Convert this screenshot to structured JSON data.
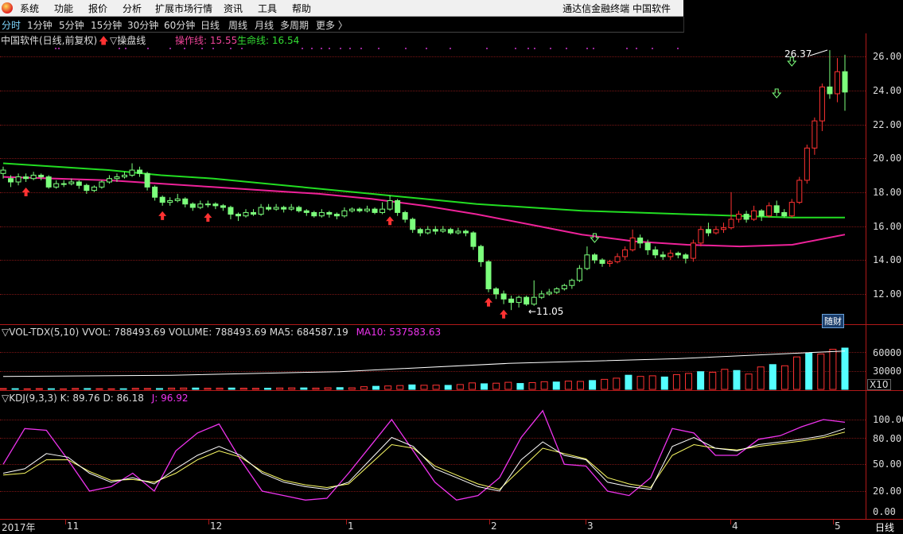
{
  "menu": {
    "items": [
      "系统",
      "功能",
      "报价",
      "分析",
      "扩展市场行情",
      "资讯",
      "工具",
      "帮助"
    ],
    "right_text": "通达信金融终端  中国软件"
  },
  "periods": {
    "items": [
      "分时",
      "1分钟",
      "5分钟",
      "15分钟",
      "30分钟",
      "60分钟",
      "日线",
      "周线",
      "月线",
      "多周期",
      "更多 〉"
    ]
  },
  "info": {
    "stock": "中国软件(日线,前复权)",
    "indicator": "▽操盘线",
    "op_line": "操作线: 15.55",
    "life_line": "生命线: 16.54"
  },
  "colors": {
    "up": "#ff3232",
    "down": "#54ffff",
    "green_candle": "#7cff7c",
    "ma_green": "#22dd22",
    "ma_pink": "#ee2299",
    "kdj_k": "#ffffff",
    "kdj_d": "#ffff66",
    "kdj_j": "#ee33ee"
  },
  "price_axis": {
    "labels": [
      "26.00",
      "24.00",
      "22.00",
      "20.00",
      "18.00",
      "16.00",
      "14.00",
      "12.00"
    ]
  },
  "annotations": {
    "high": "26.37",
    "low": "←11.05"
  },
  "badge": "随财",
  "volume": {
    "title": "▽VOL-TDX(5,10)  VVOL: 788493.69  VOLUME: 788493.69  MA5: 684587.19",
    "ma10": "MA10: 537583.63",
    "axis": [
      "60000",
      "30000"
    ],
    "unit": "X10"
  },
  "kdj": {
    "title": "▽KDJ(9,3,3)  K: 89.76  D: 86.18",
    "j": "J: 96.92",
    "axis": [
      "100.00",
      "80.00",
      "50.00",
      "20.00",
      "0.00"
    ]
  },
  "dates": {
    "labels": [
      "2017年",
      "11",
      "12",
      "1",
      "2",
      "3",
      "4",
      "5"
    ],
    "right": "日线"
  },
  "chart_data": {
    "type": "candlestick",
    "ylim": [
      11,
      26.6
    ],
    "candles": [
      [
        19.1,
        19.3,
        19.5,
        18.8
      ],
      [
        18.8,
        18.6,
        19.0,
        18.3
      ],
      [
        18.6,
        18.9,
        19.1,
        18.4
      ],
      [
        18.9,
        18.8,
        19.1,
        18.6
      ],
      [
        18.8,
        19.0,
        19.2,
        18.7
      ],
      [
        19.0,
        18.9,
        19.1,
        18.7
      ],
      [
        18.9,
        18.3,
        19.0,
        18.2
      ],
      [
        18.3,
        18.5,
        18.7,
        18.2
      ],
      [
        18.5,
        18.5,
        18.7,
        18.3
      ],
      [
        18.5,
        18.6,
        18.8,
        18.4
      ],
      [
        18.6,
        18.4,
        18.7,
        18.2
      ],
      [
        18.4,
        18.1,
        18.5,
        17.9
      ],
      [
        18.1,
        18.3,
        18.4,
        18.0
      ],
      [
        18.3,
        18.6,
        18.7,
        18.2
      ],
      [
        18.6,
        18.8,
        19.0,
        18.5
      ],
      [
        18.8,
        18.9,
        19.1,
        18.6
      ],
      [
        18.9,
        19.0,
        19.2,
        18.8
      ],
      [
        19.0,
        19.3,
        19.7,
        18.9
      ],
      [
        19.3,
        19.1,
        19.5,
        18.9
      ],
      [
        19.1,
        18.3,
        19.2,
        18.1
      ],
      [
        18.3,
        17.7,
        18.4,
        17.5
      ],
      [
        17.7,
        17.4,
        17.8,
        17.2
      ],
      [
        17.4,
        17.5,
        17.7,
        17.2
      ],
      [
        17.5,
        17.6,
        17.9,
        17.4
      ],
      [
        17.6,
        17.3,
        17.7,
        17.1
      ],
      [
        17.3,
        17.1,
        17.4,
        16.9
      ],
      [
        17.1,
        17.3,
        17.5,
        17.0
      ],
      [
        17.3,
        17.3,
        17.5,
        17.1
      ],
      [
        17.3,
        17.2,
        17.4,
        17.0
      ],
      [
        17.2,
        17.1,
        17.3,
        16.9
      ],
      [
        17.1,
        16.7,
        17.2,
        16.4
      ],
      [
        16.7,
        16.6,
        16.8,
        16.3
      ],
      [
        16.6,
        16.8,
        17.0,
        16.5
      ],
      [
        16.8,
        16.7,
        17.0,
        16.6
      ],
      [
        16.7,
        17.1,
        17.3,
        16.6
      ],
      [
        17.1,
        17.0,
        17.3,
        16.9
      ],
      [
        17.0,
        17.1,
        17.3,
        16.9
      ],
      [
        17.1,
        17.0,
        17.2,
        16.8
      ],
      [
        17.0,
        17.1,
        17.3,
        16.9
      ],
      [
        17.1,
        16.9,
        17.2,
        16.8
      ],
      [
        16.9,
        16.8,
        17.0,
        16.6
      ],
      [
        16.8,
        16.6,
        16.9,
        16.5
      ],
      [
        16.6,
        16.8,
        17.0,
        16.5
      ],
      [
        16.8,
        16.7,
        16.9,
        16.5
      ],
      [
        16.7,
        16.6,
        16.8,
        16.4
      ],
      [
        16.6,
        16.9,
        17.1,
        16.5
      ],
      [
        16.9,
        17.0,
        17.1,
        16.8
      ],
      [
        17.0,
        16.9,
        17.1,
        16.8
      ],
      [
        16.9,
        17.0,
        17.2,
        16.8
      ],
      [
        17.0,
        16.8,
        17.1,
        16.7
      ],
      [
        16.8,
        17.0,
        17.4,
        16.7
      ],
      [
        17.0,
        17.5,
        17.8,
        16.9
      ],
      [
        17.5,
        16.8,
        17.6,
        16.6
      ],
      [
        16.8,
        16.4,
        16.9,
        16.2
      ],
      [
        16.4,
        15.8,
        16.5,
        15.6
      ],
      [
        15.8,
        15.6,
        15.9,
        15.4
      ],
      [
        15.6,
        15.8,
        16.0,
        15.5
      ],
      [
        15.8,
        15.7,
        16.0,
        15.5
      ],
      [
        15.7,
        15.8,
        16.0,
        15.6
      ],
      [
        15.8,
        15.6,
        15.9,
        15.5
      ],
      [
        15.6,
        15.7,
        15.9,
        15.5
      ],
      [
        15.7,
        15.6,
        15.8,
        15.4
      ],
      [
        15.6,
        14.8,
        15.7,
        14.6
      ],
      [
        14.8,
        13.9,
        14.9,
        13.6
      ],
      [
        13.9,
        12.3,
        14.0,
        12.1
      ],
      [
        12.3,
        12.0,
        12.4,
        11.7
      ],
      [
        12.0,
        11.7,
        12.2,
        11.4
      ],
      [
        11.7,
        11.5,
        11.9,
        11.05
      ],
      [
        11.5,
        11.8,
        11.9,
        11.2
      ],
      [
        11.8,
        11.4,
        11.9,
        11.3
      ],
      [
        11.4,
        11.8,
        12.8,
        11.3
      ],
      [
        11.8,
        12.0,
        12.2,
        11.7
      ],
      [
        12.0,
        12.1,
        12.3,
        11.9
      ],
      [
        12.1,
        12.3,
        12.4,
        12.0
      ],
      [
        12.3,
        12.5,
        12.6,
        12.2
      ],
      [
        12.5,
        12.8,
        12.9,
        12.3
      ],
      [
        12.8,
        13.5,
        13.7,
        12.7
      ],
      [
        13.5,
        14.3,
        14.8,
        13.4
      ],
      [
        14.3,
        14.0,
        14.4,
        13.8
      ],
      [
        14.0,
        13.8,
        14.1,
        13.6
      ],
      [
        13.8,
        13.9,
        14.0,
        13.6
      ],
      [
        13.9,
        14.2,
        14.4,
        13.8
      ],
      [
        14.2,
        14.6,
        14.8,
        14.0
      ],
      [
        14.6,
        15.3,
        15.8,
        14.5
      ],
      [
        15.3,
        15.0,
        15.5,
        14.7
      ],
      [
        15.0,
        14.6,
        15.2,
        14.3
      ],
      [
        14.6,
        14.3,
        14.8,
        14.1
      ],
      [
        14.3,
        14.2,
        14.5,
        14.0
      ],
      [
        14.2,
        14.4,
        14.6,
        14.0
      ],
      [
        14.4,
        14.3,
        14.5,
        14.1
      ],
      [
        14.3,
        14.1,
        14.4,
        13.8
      ],
      [
        14.1,
        15.0,
        15.2,
        13.9
      ],
      [
        15.0,
        15.8,
        16.0,
        14.8
      ],
      [
        15.8,
        15.6,
        16.2,
        15.4
      ],
      [
        15.6,
        15.8,
        16.0,
        15.5
      ],
      [
        15.8,
        15.9,
        16.2,
        15.6
      ],
      [
        15.9,
        16.4,
        18.0,
        15.8
      ],
      [
        16.4,
        16.7,
        16.9,
        16.2
      ],
      [
        16.7,
        16.4,
        16.9,
        16.2
      ],
      [
        16.4,
        16.9,
        17.2,
        16.3
      ],
      [
        16.9,
        16.6,
        17.0,
        16.3
      ],
      [
        16.6,
        17.2,
        17.4,
        16.5
      ],
      [
        17.2,
        16.8,
        17.5,
        16.6
      ],
      [
        16.8,
        16.6,
        17.0,
        16.5
      ],
      [
        16.6,
        17.4,
        17.6,
        16.5
      ],
      [
        17.4,
        18.7,
        18.9,
        17.3
      ],
      [
        18.7,
        20.6,
        20.8,
        18.5
      ],
      [
        20.6,
        22.2,
        22.4,
        20.2
      ],
      [
        22.2,
        24.2,
        24.4,
        21.6
      ],
      [
        24.2,
        23.8,
        26.37,
        23.5
      ],
      [
        23.8,
        25.1,
        25.9,
        23.3
      ],
      [
        25.1,
        23.9,
        26.1,
        22.8
      ]
    ],
    "ma_green": [
      19.7,
      19.5,
      19.3,
      19.0,
      18.8,
      18.5,
      18.2,
      17.9,
      17.6,
      17.3,
      17.1,
      16.9,
      16.8,
      16.7,
      16.6,
      16.5,
      16.5
    ],
    "ma_pink": [
      18.9,
      18.8,
      18.7,
      18.5,
      18.3,
      18.1,
      17.9,
      17.6,
      17.2,
      16.7,
      16.1,
      15.5,
      15.1,
      14.9,
      14.8,
      14.9,
      15.5
    ],
    "volume_values": [
      1500,
      1200,
      1000,
      1300,
      1100,
      900,
      1600,
      1400,
      1200,
      1000,
      1100,
      1800,
      1600,
      1400,
      2200,
      2400,
      2300,
      1900,
      2100,
      2300,
      2000,
      1800,
      1900,
      2400,
      2600,
      2500,
      2200,
      2800,
      3000,
      2700,
      4500,
      5200,
      5800,
      6500,
      7600,
      7000,
      7200,
      6800,
      8200,
      11000,
      9500,
      10500,
      12000,
      10000,
      11500,
      13000,
      12500,
      14000,
      13500,
      15000,
      17000,
      19000,
      24000,
      22000,
      23000,
      21000,
      25000,
      27000,
      30000,
      29000,
      34000,
      32000,
      26000,
      38000,
      42000,
      40000,
      55000,
      62000,
      60000,
      68000,
      70000
    ],
    "volume_ma": [
      22000,
      24000,
      30000,
      44000,
      52000,
      65000
    ],
    "kdj_k": [
      40,
      45,
      62,
      58,
      40,
      30,
      35,
      28,
      45,
      60,
      70,
      60,
      40,
      30,
      25,
      22,
      30,
      55,
      80,
      70,
      45,
      35,
      25,
      20,
      55,
      75,
      60,
      55,
      30,
      25,
      22,
      70,
      80,
      68,
      65,
      72,
      75,
      78,
      82,
      90
    ],
    "kdj_d": [
      38,
      40,
      55,
      55,
      42,
      32,
      33,
      30,
      40,
      55,
      65,
      58,
      42,
      32,
      27,
      24,
      28,
      50,
      72,
      68,
      48,
      38,
      28,
      22,
      45,
      68,
      62,
      56,
      35,
      28,
      24,
      60,
      72,
      68,
      66,
      70,
      73,
      76,
      80,
      86
    ],
    "kdj_j": [
      50,
      90,
      88,
      55,
      20,
      25,
      40,
      20,
      65,
      85,
      95,
      55,
      20,
      15,
      10,
      12,
      40,
      70,
      100,
      65,
      30,
      10,
      15,
      35,
      80,
      110,
      50,
      48,
      20,
      15,
      35,
      90,
      85,
      60,
      60,
      78,
      82,
      92,
      100,
      97
    ]
  }
}
